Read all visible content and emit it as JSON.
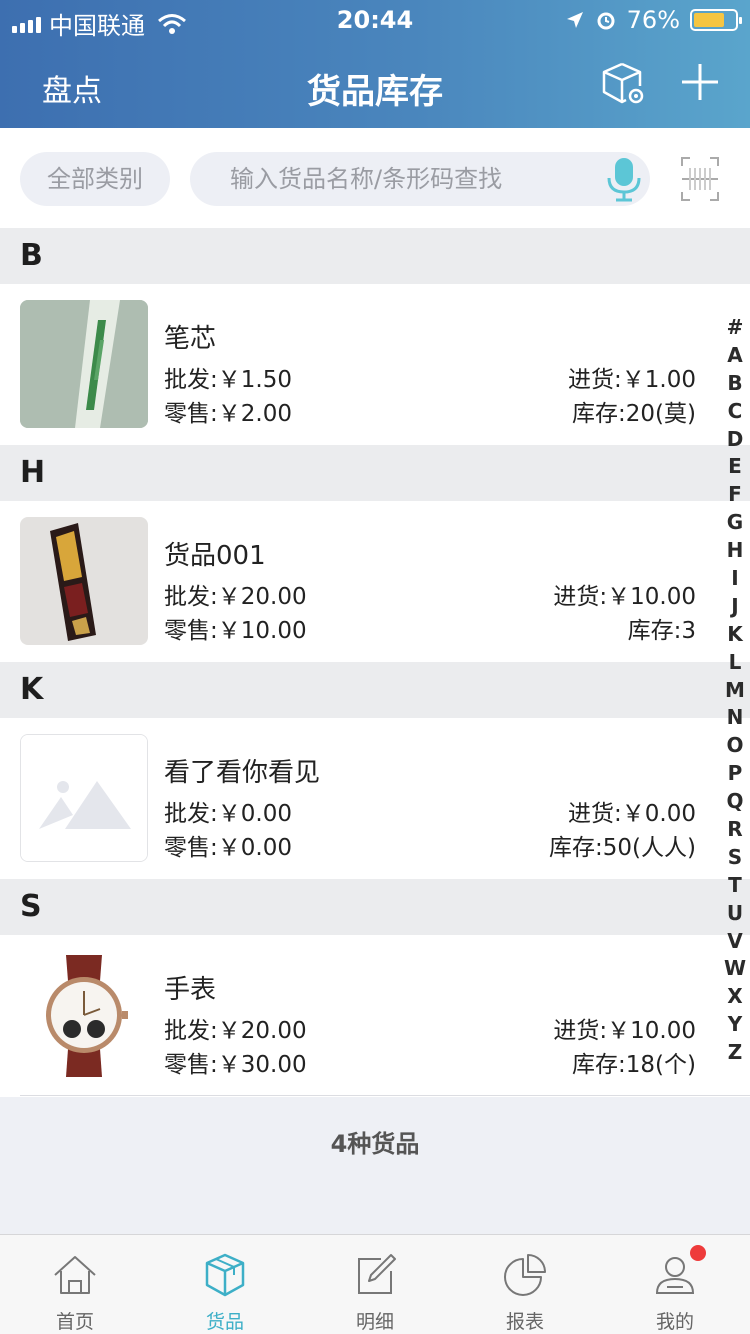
{
  "status": {
    "carrier": "中国联通",
    "time": "20:44",
    "battery": "76%",
    "battery_level": 0.76
  },
  "nav": {
    "left_label": "盘点",
    "title": "货品库存",
    "icons": [
      "box-settings-icon",
      "plus-icon"
    ]
  },
  "search": {
    "category_label": "全部类别",
    "placeholder": "输入货品名称/条形码查找",
    "icons": [
      "microphone-icon",
      "barcode-scan-icon"
    ]
  },
  "sections": [
    {
      "letter": "B",
      "item": {
        "name": "笔芯",
        "wholesale": "批发:￥1.50",
        "retail": "零售:￥2.00",
        "purchase": "进货:￥1.00",
        "stock": "库存:20(莫)"
      }
    },
    {
      "letter": "H",
      "item": {
        "name": "货品001",
        "wholesale": "批发:￥20.00",
        "retail": "零售:￥10.00",
        "purchase": "进货:￥10.00",
        "stock": "库存:3"
      }
    },
    {
      "letter": "K",
      "item": {
        "name": "看了看你看见",
        "wholesale": "批发:￥0.00",
        "retail": "零售:￥0.00",
        "purchase": "进货:￥0.00",
        "stock": "库存:50(人人)"
      }
    },
    {
      "letter": "S",
      "item": {
        "name": "手表",
        "wholesale": "批发:￥20.00",
        "retail": "零售:￥30.00",
        "purchase": "进货:￥10.00",
        "stock": "库存:18(个)"
      }
    }
  ],
  "index_letters": [
    "#",
    "A",
    "B",
    "C",
    "D",
    "E",
    "F",
    "G",
    "H",
    "I",
    "J",
    "K",
    "L",
    "M",
    "N",
    "O",
    "P",
    "Q",
    "R",
    "S",
    "T",
    "U",
    "V",
    "W",
    "X",
    "Y",
    "Z"
  ],
  "summary": "4种货品",
  "tabs": [
    {
      "label": "首页",
      "icon": "home-icon",
      "active": false
    },
    {
      "label": "货品",
      "icon": "box-icon",
      "active": true
    },
    {
      "label": "明细",
      "icon": "edit-icon",
      "active": false
    },
    {
      "label": "报表",
      "icon": "pie-chart-icon",
      "active": false
    },
    {
      "label": "我的",
      "icon": "user-icon",
      "active": false
    }
  ],
  "colors": {
    "header_start": "#3d6fb0",
    "header_end": "#5aa5cc",
    "accent": "#3dafc7",
    "badge": "#ee3b3b"
  }
}
